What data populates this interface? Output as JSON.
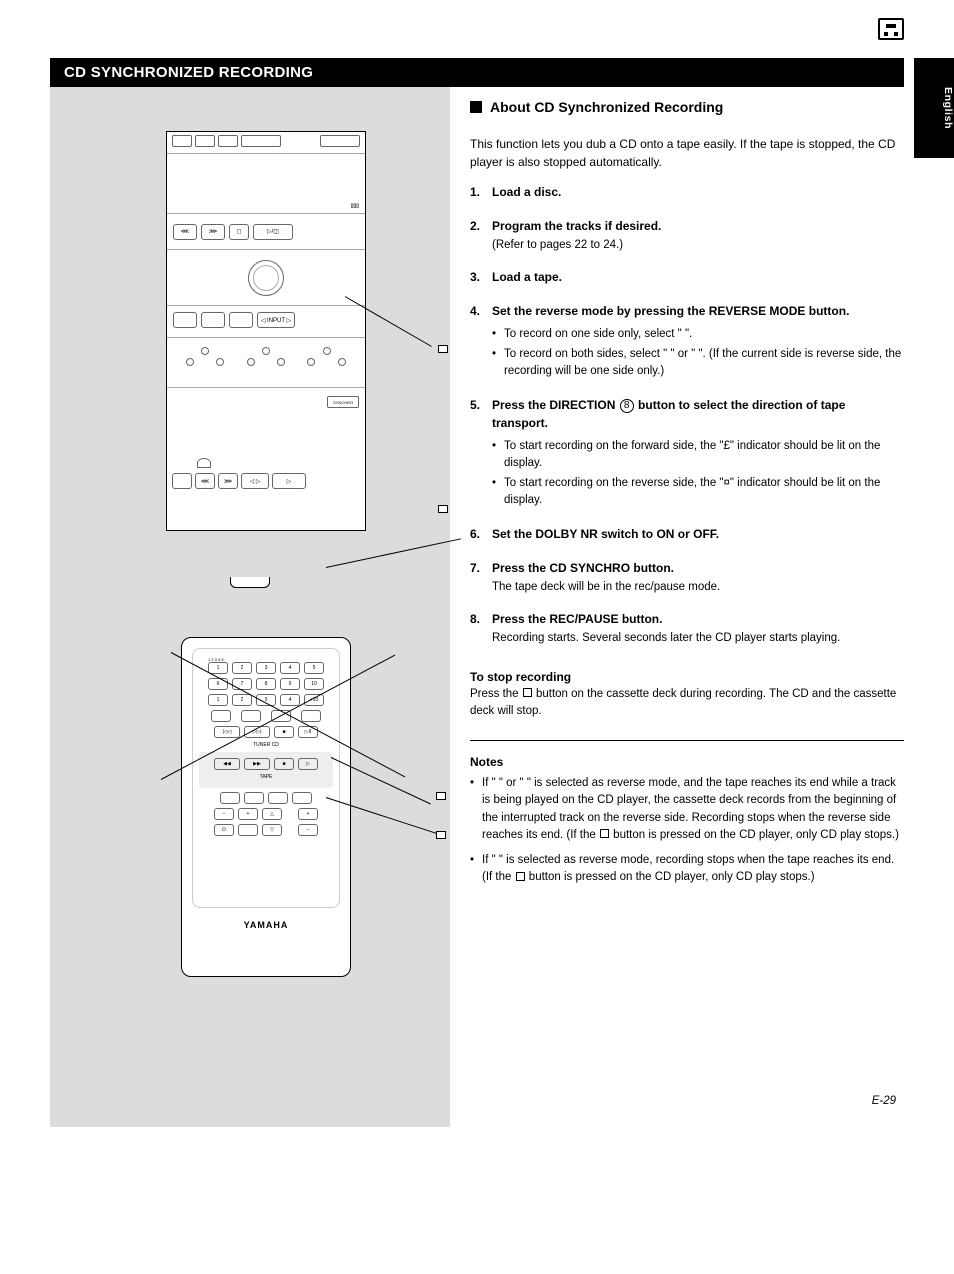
{
  "header": {
    "icon_name": "cassette-icon"
  },
  "title": "CD SYNCHRONIZED RECORDING",
  "margin_label": "English",
  "page_number": "E-29",
  "section_heading": "About CD Synchronized Recording",
  "lead_paragraph": "This function lets you dub a CD onto a tape easily. If the tape is stopped, the CD player is also stopped automatically.",
  "steps": [
    {
      "num": "1.",
      "main": "Load a disc.",
      "sub": null,
      "bullets": []
    },
    {
      "num": "2.",
      "main": "Program the tracks if desired.",
      "sub": "(Refer to pages 22 to 24.)",
      "bullets": []
    },
    {
      "num": "3.",
      "main": "Load a tape.",
      "sub": null,
      "bullets": []
    },
    {
      "num": "4.",
      "main": "Set the reverse mode by pressing the REVERSE MODE button.",
      "bullets": [
        "To record on one side only, select \"      \".",
        "To record on both sides, select \"      \" or \"      \". (If the current side is reverse side, the recording will be one side only.)"
      ]
    },
    {
      "num": "5.",
      "main_prefix": "Press the DIRECTION ",
      "main_suffix": " button to select the direction of tape transport.",
      "bullets": [
        "To start recording on the forward side, the \"£\" indicator should be lit on the display.",
        "To start recording on the reverse side, the \"¤\" indicator should be lit on the display."
      ]
    },
    {
      "num": "6.",
      "main": "Set the DOLBY NR switch to ON or OFF.",
      "sub": null,
      "bullets": []
    },
    {
      "num": "7.",
      "main": "Press the CD SYNCHRO button.",
      "sub": "The tape deck will be in the rec/pause mode.",
      "bullets": []
    },
    {
      "num": "8.",
      "main": "Press the REC/PAUSE button.",
      "sub": "Recording starts. Several seconds later the CD player starts playing.",
      "bullets": []
    }
  ],
  "stop": {
    "heading": "To stop recording",
    "body_prefix": "Press the ",
    "body_suffix": " button on the cassette deck during recording. The CD and the cassette deck will stop."
  },
  "notes": {
    "heading": "Notes",
    "items": [
      {
        "prefix": "If \"      \" or \"      \" is selected as reverse mode, and the tape reaches its end while a track is being played on the CD player, the cassette deck records from the beginning of the interrupted track on the reverse side. Recording stops when the reverse side reaches its end. (If the ",
        "suffix": " button is pressed on the CD player, only CD play stops.)"
      },
      {
        "prefix": "If \"      \" is selected as reverse mode, recording stops when the tape reaches its end. (If the ",
        "suffix": " button is pressed on the CD player, only CD play stops.)"
      }
    ]
  },
  "remote_brand": "YAMAHA",
  "stereo_labels": {
    "cd_stop": "CD Stop",
    "tape_stop": "Tape Stop",
    "tape_label": "TAPE",
    "tuner_cd_label": "TUNER   CD"
  }
}
